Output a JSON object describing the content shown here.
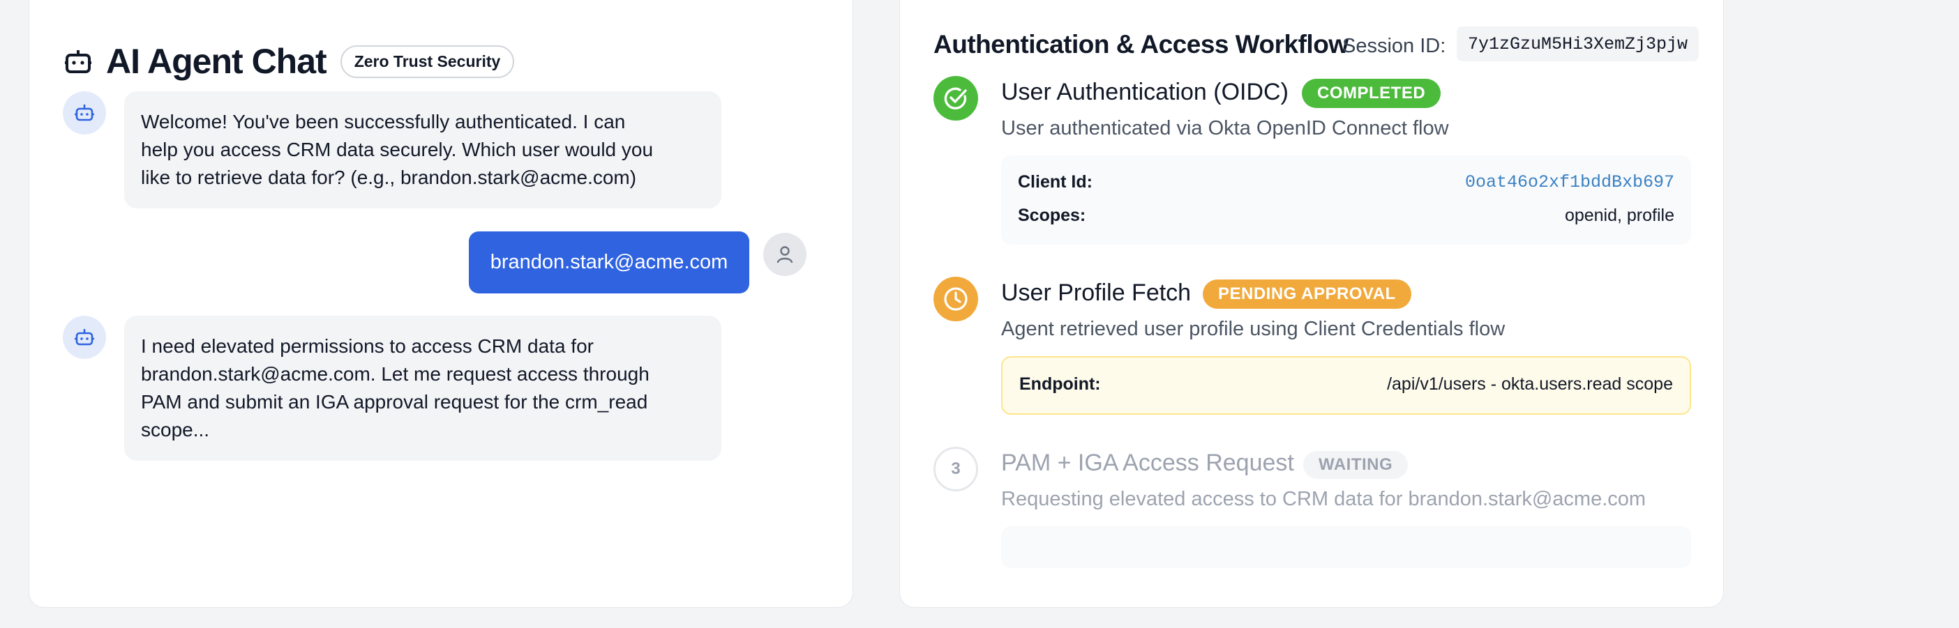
{
  "colors": {
    "accent": "#2f63e0",
    "completed": "#4cbb3c",
    "pending": "#f2a93b",
    "waiting": "#9ca3af"
  },
  "chat": {
    "title": "AI Agent Chat",
    "header_icon": "robot-icon",
    "security_badge": "Zero Trust Security",
    "messages": [
      {
        "role": "agent",
        "icon": "robot-icon",
        "lines": [
          "Welcome! You've been successfully authenticated. I can",
          "help you access CRM data securely. Which user would you",
          "like to retrieve data for? (e.g., brandon.stark@acme.com)"
        ]
      },
      {
        "role": "user",
        "icon": "user-icon",
        "text": "brandon.stark@acme.com"
      },
      {
        "role": "agent",
        "icon": "robot-icon",
        "lines": [
          "I need elevated permissions to access CRM data for",
          "brandon.stark@acme.com. Let me request access through",
          "PAM and submit an IGA approval request for the crm_read",
          "scope..."
        ]
      }
    ]
  },
  "workflow": {
    "title": "Authentication & Access Workflow",
    "session_label": "Session ID:",
    "session_id": "7y1zGzuM5Hi3XemZj3pjw",
    "steps": [
      {
        "title": "User Authentication (OIDC)",
        "status": "COMPLETED",
        "icon": "check-circle-icon",
        "description": "User authenticated via Okta OpenID Connect flow",
        "details": [
          {
            "key": "Client Id:",
            "value": "0oat46o2xf1bddBxb697"
          },
          {
            "key": "Scopes:",
            "value": "openid, profile"
          }
        ]
      },
      {
        "title": "User Profile Fetch",
        "status": "PENDING APPROVAL",
        "icon": "clock-icon",
        "description": "Agent retrieved user profile using Client Credentials flow",
        "details": [
          {
            "key": "Endpoint:",
            "value": "/api/v1/users - okta.users.read scope"
          }
        ]
      },
      {
        "title": "PAM + IGA Access Request",
        "status": "WAITING",
        "number": "3",
        "description": "Requesting elevated access to CRM data for brandon.stark@acme.com"
      }
    ]
  }
}
